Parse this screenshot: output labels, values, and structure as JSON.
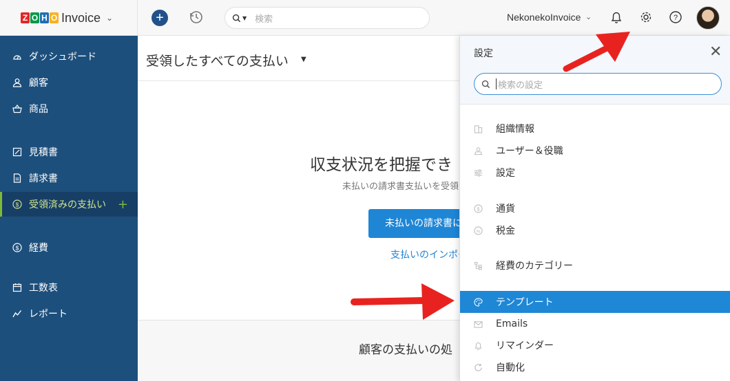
{
  "brand": {
    "letters": [
      "Z",
      "O",
      "H",
      "O"
    ],
    "name": "Invoice"
  },
  "header": {
    "search_placeholder": "検索",
    "org_name": "NekonekoInvoice"
  },
  "sidebar": {
    "items": [
      {
        "label": "ダッシュボード",
        "icon": "dashboard-icon"
      },
      {
        "label": "顧客",
        "icon": "user-icon"
      },
      {
        "label": "商品",
        "icon": "basket-icon"
      },
      {
        "label": "見積書",
        "icon": "estimate-icon"
      },
      {
        "label": "請求書",
        "icon": "invoice-icon"
      },
      {
        "label": "受領済みの支払い",
        "icon": "dollar-circle-icon",
        "active": true
      },
      {
        "label": "経費",
        "icon": "dollar-circle-icon"
      },
      {
        "label": "工数表",
        "icon": "calendar-icon"
      },
      {
        "label": "レポート",
        "icon": "chart-line-icon"
      }
    ]
  },
  "main": {
    "title": "受領したすべての支払い",
    "empty_title": "収支状況を把握でき",
    "empty_subtitle": "未払いの請求書支払いを受領",
    "primary_button": "未払いの請求書に",
    "import_link": "支払いのインポー",
    "bottom_title": "顧客の支払いの処"
  },
  "settings_panel": {
    "title": "設定",
    "search_placeholder": "検索の設定",
    "items": [
      {
        "label": "組織情報",
        "icon": "building-icon"
      },
      {
        "label": "ユーザー＆役職",
        "icon": "users-icon"
      },
      {
        "label": "設定",
        "icon": "sliders-icon"
      },
      {
        "label": "通貨",
        "icon": "currency-icon"
      },
      {
        "label": "税金",
        "icon": "percent-icon"
      },
      {
        "label": "経費のカテゴリー",
        "icon": "category-tree-icon"
      },
      {
        "label": "テンプレート",
        "icon": "palette-icon",
        "active": true
      },
      {
        "label": "Emails",
        "icon": "mail-icon"
      },
      {
        "label": "リマインダー",
        "icon": "bell-icon"
      },
      {
        "label": "自動化",
        "icon": "refresh-icon"
      }
    ]
  },
  "colors": {
    "sidebar": "#1d4f7c",
    "accent_green": "#7fb93a",
    "primary_blue": "#1f86d6",
    "annotation_red": "#e8231f"
  }
}
